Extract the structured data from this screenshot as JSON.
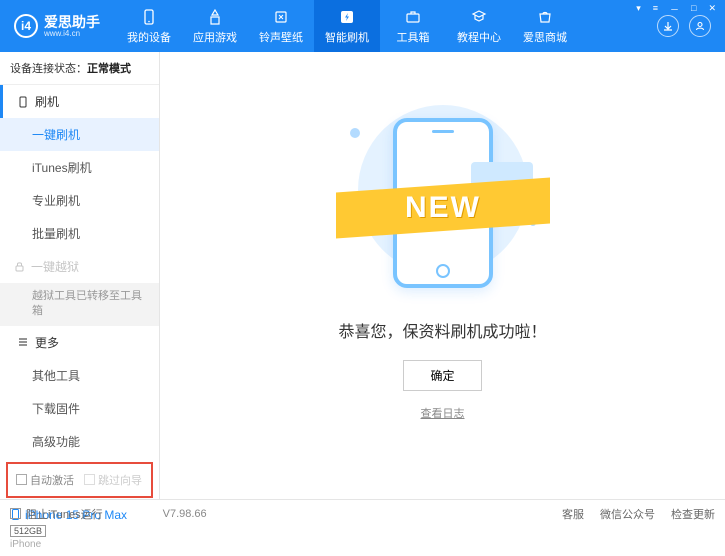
{
  "app": {
    "name": "爱思助手",
    "url": "www.i4.cn"
  },
  "windowControls": {
    "menu": "▾",
    "tray": "≡",
    "min": "－",
    "max": "□",
    "close": "✕"
  },
  "nav": [
    {
      "label": "我的设备"
    },
    {
      "label": "应用游戏"
    },
    {
      "label": "铃声壁纸"
    },
    {
      "label": "智能刷机"
    },
    {
      "label": "工具箱"
    },
    {
      "label": "教程中心"
    },
    {
      "label": "爱思商城"
    }
  ],
  "status": {
    "prefix": "设备连接状态：",
    "value": "正常模式"
  },
  "sidebar": {
    "flashHeader": "刷机",
    "items": [
      "一键刷机",
      "iTunes刷机",
      "专业刷机",
      "批量刷机"
    ],
    "jailbreakHeader": "一键越狱",
    "jailbreakNote": "越狱工具已转移至工具箱",
    "moreHeader": "更多",
    "moreItems": [
      "其他工具",
      "下载固件",
      "高级功能"
    ]
  },
  "checks": {
    "autoActivate": "自动激活",
    "skipGuide": "跳过向导"
  },
  "device": {
    "name": "iPhone 15 Pro Max",
    "storage": "512GB",
    "type": "iPhone"
  },
  "main": {
    "bannerText": "NEW",
    "successText": "恭喜您，保资料刷机成功啦！",
    "okButton": "确定",
    "logLink": "查看日志"
  },
  "footer": {
    "blockItunes": "阻止iTunes运行",
    "version": "V7.98.66",
    "links": [
      "客服",
      "微信公众号",
      "检查更新"
    ]
  }
}
